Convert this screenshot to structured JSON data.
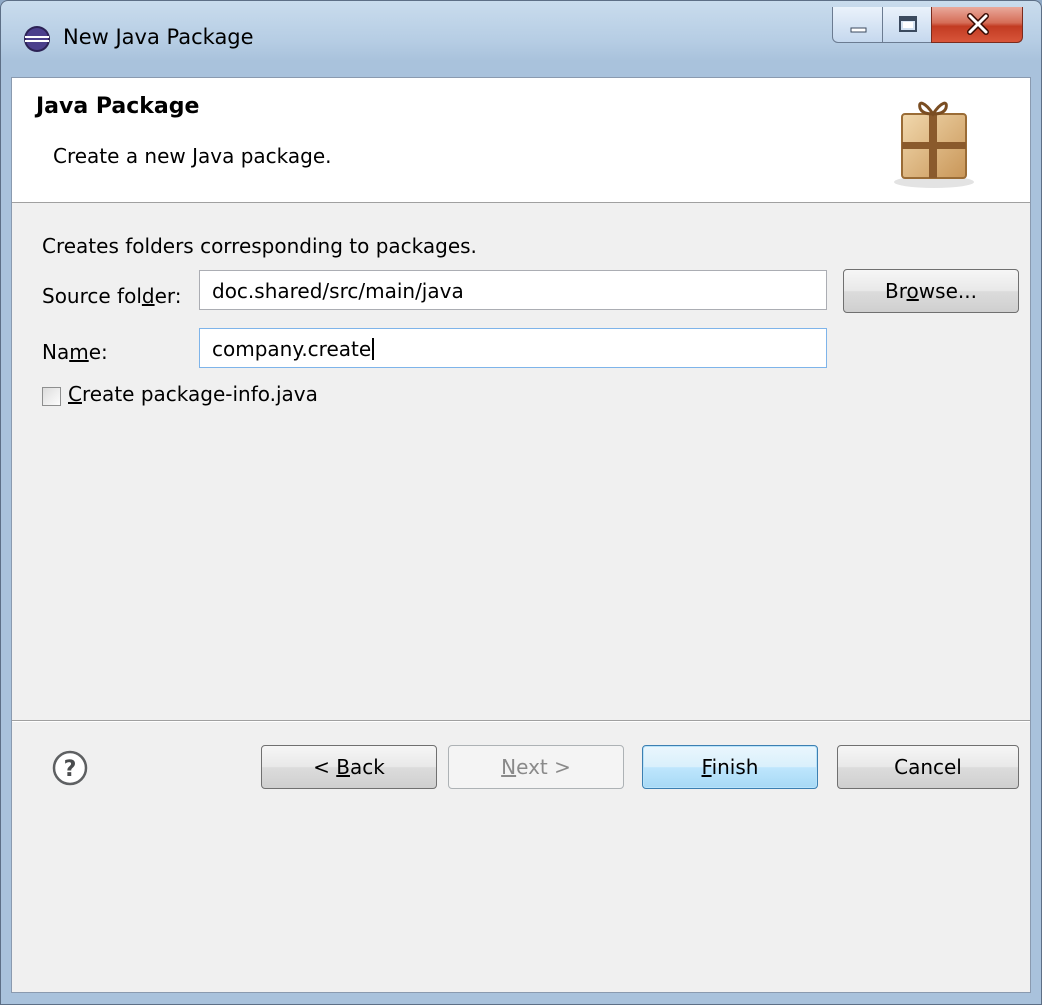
{
  "window": {
    "title": "New Java Package",
    "icon": "eclipse-icon",
    "controls": [
      "minimize-icon",
      "maximize-icon",
      "close-icon"
    ]
  },
  "banner": {
    "title": "Java Package",
    "description": "Create a new Java package.",
    "icon": "package-icon"
  },
  "form": {
    "intro": "Creates folders corresponding to packages.",
    "source_folder": {
      "label_pre": "Source fol",
      "label_mnemonic": "d",
      "label_post": "er:",
      "value": "doc.shared/src/main/java"
    },
    "browse": {
      "pre": "Br",
      "mnemonic": "o",
      "post": "wse..."
    },
    "name": {
      "label_pre": "Na",
      "label_mnemonic": "m",
      "label_post": "e:",
      "value": "company.create"
    },
    "package_info": {
      "checked": false,
      "mnemonic": "C",
      "rest": "reate package-info.java"
    }
  },
  "footer": {
    "help_icon": "help-icon",
    "back": {
      "pre": "< ",
      "mnemonic": "B",
      "post": "ack"
    },
    "next": {
      "mnemonic": "N",
      "post": "ext >"
    },
    "finish": {
      "mnemonic": "F",
      "post": "inish"
    },
    "cancel": "Cancel"
  },
  "colors": {
    "frame": "#a9c2dc",
    "client": "#f0f0f0",
    "default_button": "#bee6fd",
    "close_button": "#c23b22"
  }
}
